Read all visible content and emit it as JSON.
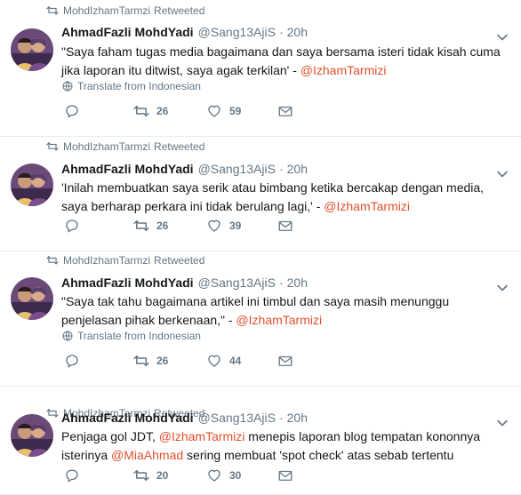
{
  "colors": {
    "accent": "#e0502d",
    "muted": "#657786",
    "text": "#14171a",
    "divider": "#e6ecf0"
  },
  "tweets": [
    {
      "retweeter": "MohdIzhamTarmzi",
      "retweet_suffix": "Retweeted",
      "fullname": "AhmadFazli MohdYadi",
      "handle": "@Sang13AjiS",
      "dot": "·",
      "time": "20h",
      "lines": [
        [
          "\"Saya faham tugas media bagaimana dan saya bersama isteri tidak kisah cuma"
        ],
        [
          "jika laporan itu ditwist, saya agak terkilan' - ",
          {
            "mention": "@IzhamTarmizi"
          }
        ]
      ],
      "translate": "Translate from Indonesian",
      "retweets": "26",
      "likes": "59"
    },
    {
      "retweeter": "MohdIzhamTarmzi",
      "retweet_suffix": "Retweeted",
      "fullname": "AhmadFazli MohdYadi",
      "handle": "@Sang13AjiS",
      "dot": "·",
      "time": "20h",
      "lines": [
        [
          "'Inilah membuatkan saya serik atau bimbang ketika bercakap dengan media,"
        ],
        [
          "saya berharap perkara ini tidak berulang lagi,' - ",
          {
            "mention": "@IzhamTarmizi"
          }
        ]
      ],
      "translate": "",
      "retweets": "26",
      "likes": "39"
    },
    {
      "retweeter": "MohdIzhamTarmzi",
      "retweet_suffix": "Retweeted",
      "fullname": "AhmadFazli MohdYadi",
      "handle": "@Sang13AjiS",
      "dot": "·",
      "time": "20h",
      "lines": [
        [
          "\"Saya tak tahu bagaimana artikel ini timbul dan saya masih menunggu"
        ],
        [
          "penjelasan pihak berkenaan,\" - ",
          {
            "mention": "@IzhamTarmizi"
          }
        ]
      ],
      "translate": "Translate from Indonesian",
      "retweets": "26",
      "likes": "44"
    },
    {
      "retweeter": "MohdIzhamTarmzi",
      "retweet_suffix": "Retweeted",
      "fullname": "AhmadFazli MohdYadi",
      "handle": "@Sang13AjiS",
      "dot": "·",
      "time": "20h",
      "lines": [
        [
          "Penjaga gol JDT, ",
          {
            "mention": "@IzhamTarmizi"
          },
          " menepis laporan blog tempatan kononnya"
        ],
        [
          "isterinya ",
          {
            "mention": "@MiaAhmad"
          },
          " sering membuat 'spot check' atas sebab tertentu"
        ]
      ],
      "translate": "",
      "retweets": "20",
      "likes": "30"
    }
  ]
}
